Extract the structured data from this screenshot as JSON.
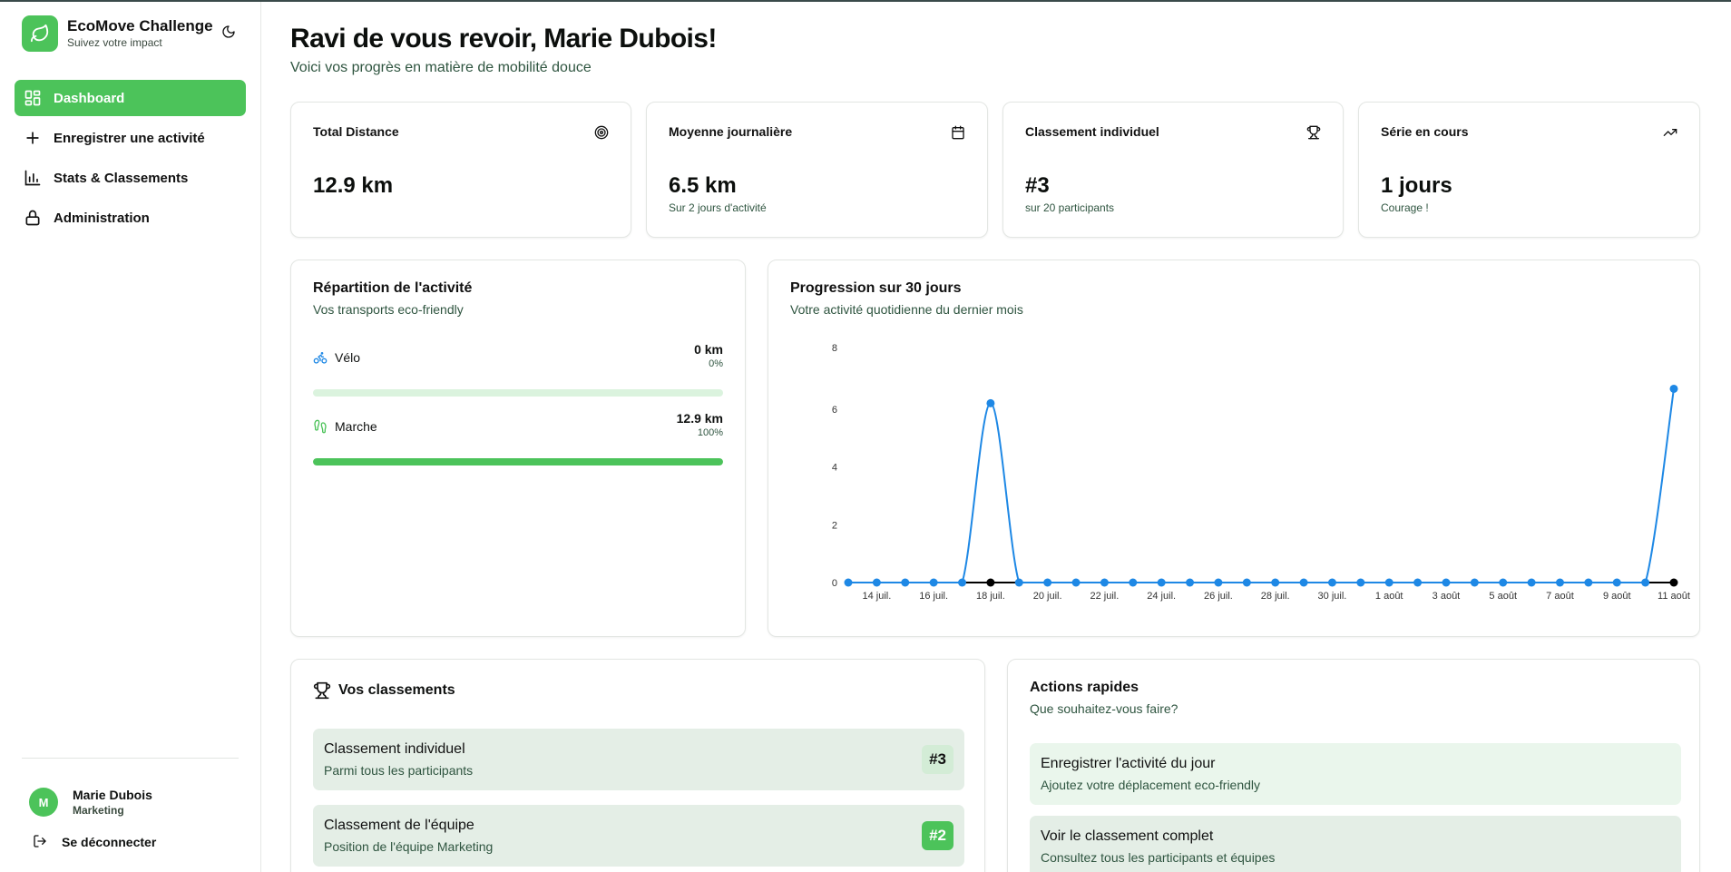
{
  "app": {
    "title": "EcoMove Challenge",
    "subtitle": "Suivez votre impact"
  },
  "nav": [
    {
      "label": "Dashboard",
      "icon": "dashboard-grid-icon",
      "active": true
    },
    {
      "label": "Enregistrer une activité",
      "icon": "plus-icon"
    },
    {
      "label": "Stats & Classements",
      "icon": "bar-chart-icon"
    },
    {
      "label": "Administration",
      "icon": "lock-icon"
    }
  ],
  "user": {
    "initial": "M",
    "name": "Marie Dubois",
    "team": "Marketing",
    "logout_label": "Se déconnecter"
  },
  "header": {
    "title": "Ravi de vous revoir, Marie Dubois!",
    "subtitle": "Voici vos progrès en matière de mobilité douce"
  },
  "stats": [
    {
      "title": "Total Distance",
      "value": "12.9 km",
      "note": "",
      "icon": "target-icon"
    },
    {
      "title": "Moyenne journalière",
      "value": "6.5 km",
      "note": "Sur 2 jours d'activité",
      "icon": "calendar-icon"
    },
    {
      "title": "Classement individuel",
      "value": "#3",
      "note": "sur 20 participants",
      "icon": "trophy-icon"
    },
    {
      "title": "Série en cours",
      "value": "1 jours",
      "note": "Courage !",
      "icon": "trending-up-icon"
    }
  ],
  "activity_split": {
    "title": "Répartition de l'activité",
    "subtitle": "Vos transports eco-friendly",
    "modes": [
      {
        "label": "Vélo",
        "km": "0 km",
        "pct_label": "0%",
        "fraction": 0,
        "icon": "bike-icon"
      },
      {
        "label": "Marche",
        "km": "12.9 km",
        "pct_label": "100%",
        "fraction": 1,
        "icon": "footprints-icon"
      }
    ]
  },
  "progress_chart": {
    "title": "Progression sur 30 jours",
    "subtitle": "Votre activité quotidienne du dernier mois"
  },
  "chart_data": {
    "type": "line",
    "x": [
      "13 juil.",
      "14 juil.",
      "15 juil.",
      "16 juil.",
      "17 juil.",
      "18 juil.",
      "19 juil.",
      "20 juil.",
      "21 juil.",
      "22 juil.",
      "23 juil.",
      "24 juil.",
      "25 juil.",
      "26 juil.",
      "27 juil.",
      "28 juil.",
      "29 juil.",
      "30 juil.",
      "31 juil.",
      "1 août",
      "2 août",
      "3 août",
      "4 août",
      "5 août",
      "6 août",
      "7 août",
      "8 août",
      "9 août",
      "10 août",
      "11 août"
    ],
    "x_tick_labels": [
      "14 juil.",
      "16 juil.",
      "18 juil.",
      "20 juil.",
      "22 juil.",
      "24 juil.",
      "26 juil.",
      "28 juil.",
      "30 juil.",
      "1 août",
      "3 août",
      "5 août",
      "7 août",
      "9 août",
      "11 août"
    ],
    "series": [
      {
        "values": [
          0,
          0,
          0,
          0,
          0,
          6.2,
          0,
          0,
          0,
          0,
          0,
          0,
          0,
          0,
          0,
          0,
          0,
          0,
          0,
          0,
          0,
          0,
          0,
          0,
          0,
          0,
          0,
          0,
          0,
          6.7
        ],
        "color": "#1e88e5"
      },
      {
        "values": [
          0,
          0,
          0,
          0,
          0,
          0,
          0,
          0,
          0,
          0,
          0,
          0,
          0,
          0,
          0,
          0,
          0,
          0,
          0,
          0,
          0,
          0,
          0,
          0,
          0,
          0,
          0,
          0,
          0,
          0
        ],
        "color": "#000000"
      }
    ],
    "y_ticks": [
      0,
      2,
      4,
      6,
      8
    ],
    "ylim": [
      0,
      8
    ],
    "grid": false,
    "xlabel": "",
    "ylabel": "",
    "title": ""
  },
  "rankings": {
    "title": "Vos classements",
    "items": [
      {
        "title": "Classement individuel",
        "subtitle": "Parmi tous les participants",
        "badge": "#3"
      },
      {
        "title": "Classement de l'équipe",
        "subtitle": "Position de l'équipe Marketing",
        "badge": "#2"
      }
    ]
  },
  "quick_actions": {
    "title": "Actions rapides",
    "subtitle": "Que souhaitez-vous faire?",
    "items": [
      {
        "title": "Enregistrer l'activité du jour",
        "subtitle": "Ajoutez votre déplacement eco-friendly"
      },
      {
        "title": "Voir le classement complet",
        "subtitle": "Consultez tous les participants et équipes"
      }
    ]
  },
  "colors": {
    "brand": "#4cc35a",
    "chart_line": "#1e88e5",
    "bar_track": "#dbf3de",
    "soft_green": "#e4eee6"
  }
}
